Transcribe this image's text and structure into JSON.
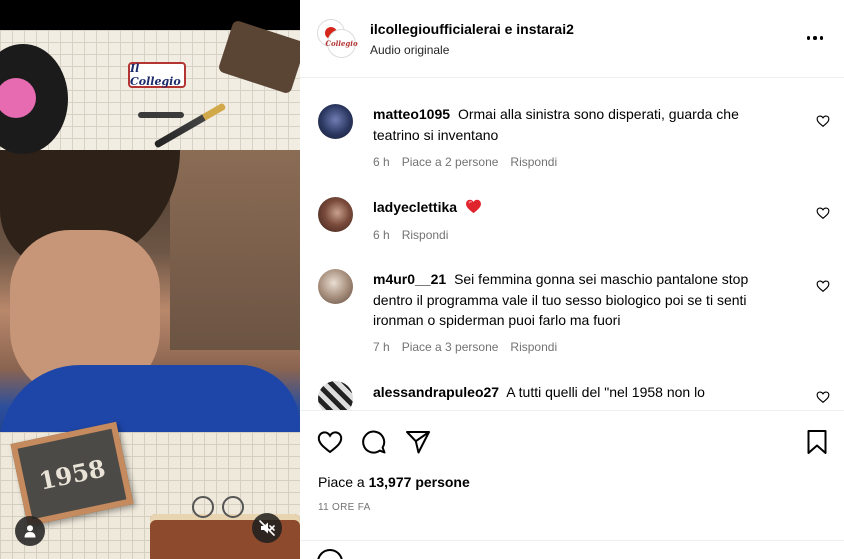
{
  "post": {
    "authors": {
      "primary": "ilcollegioufficialerai",
      "conjunction": "e",
      "secondary": "instarai2"
    },
    "audio_label": "Audio originale"
  },
  "media": {
    "logo_text": "Il Collegio",
    "chalkboard_year": "1958",
    "mute_icon": "speaker-muted-icon",
    "user_tag_icon": "user-icon"
  },
  "comments": [
    {
      "username": "matteo1095",
      "text": "Ormai alla sinistra sono disperati, guarda che teatrino si inventano",
      "time": "6 h",
      "likes": "Piace a 2 persone",
      "reply": "Rispondi"
    },
    {
      "username": "ladyeclettika",
      "text": "",
      "emoji": "heart-emoji",
      "time": "6 h",
      "likes": "",
      "reply": "Rispondi"
    },
    {
      "username": "m4ur0__21",
      "text": "Sei femmina gonna sei maschio pantalone stop dentro il programma vale il tuo sesso biologico poi se ti senti ironman o spiderman puoi farlo ma fuori",
      "time": "7 h",
      "likes": "Piace a 3 persone",
      "reply": "Rispondi"
    },
    {
      "username": "alessandrapuleo27",
      "text": "A tutti quelli del \"nel 1958 non lo",
      "time": "",
      "likes": "",
      "reply": ""
    }
  ],
  "actions": {
    "like_icon": "heart-outline-icon",
    "comment_icon": "comment-bubble-icon",
    "share_icon": "paper-plane-icon",
    "save_icon": "bookmark-icon"
  },
  "likes_summary": {
    "prefix": "Piace a",
    "count": "13,977",
    "suffix": "persone"
  },
  "time_ago": "11 ORE FA",
  "colors": {
    "heart_emoji": "#e0242e",
    "muted_text": "#737373",
    "divider": "#efefef"
  }
}
